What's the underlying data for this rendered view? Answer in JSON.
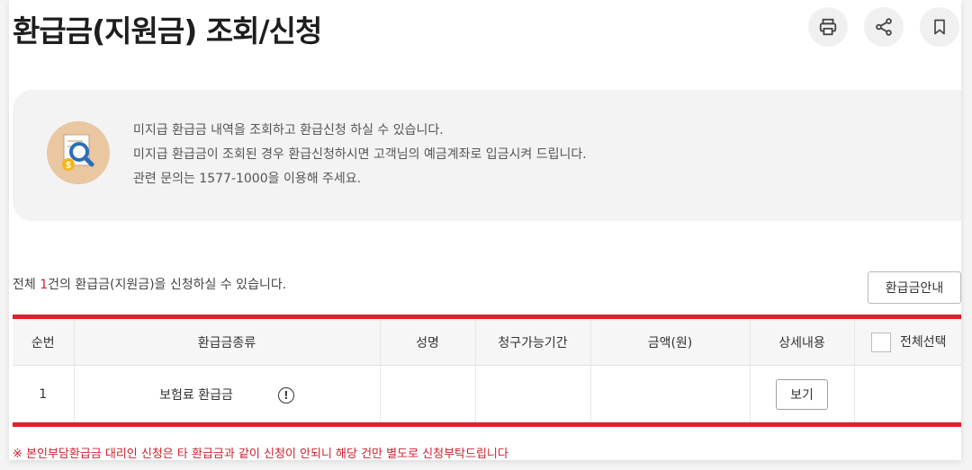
{
  "page": {
    "title": "환급금(지원금) 조회/신청"
  },
  "toolbar": {
    "icons": [
      "printer-icon",
      "share-icon",
      "bookmark-icon"
    ],
    "accent": "#e0202b"
  },
  "info": {
    "icon": "search-magnifier-icon",
    "lines": [
      "미지급 환급금 내역을 조회하고 환급신청 하실 수 있습니다.",
      "미지급 환급금이 조회된 경우 환급신청하시면 고객님의 예금계좌로 입금시켜 드립니다.",
      "관련 문의는 1577-1000을 이용해 주세요."
    ]
  },
  "summary": {
    "prefix": "전체 ",
    "count": "1",
    "suffix": "건의 환급금(지원금)을 신청하실 수 있습니다."
  },
  "guide_button": "환급금안내",
  "table": {
    "headers": {
      "no": "순번",
      "type": "환급금종류",
      "name": "성명",
      "period": "청구가능기간",
      "amount": "금액(원)",
      "detail": "상세내용",
      "select_all": "전체선택"
    },
    "rows": [
      {
        "no": "1",
        "type": "보험료 환급금",
        "name": "",
        "period": "",
        "amount": "",
        "view_label": "보기"
      }
    ]
  },
  "notice": "※ 본인부담환급금 대리인 신청은 타 환급금과 같이 신청이 안되니 해당 건만 별도로 신청부탁드립니다"
}
